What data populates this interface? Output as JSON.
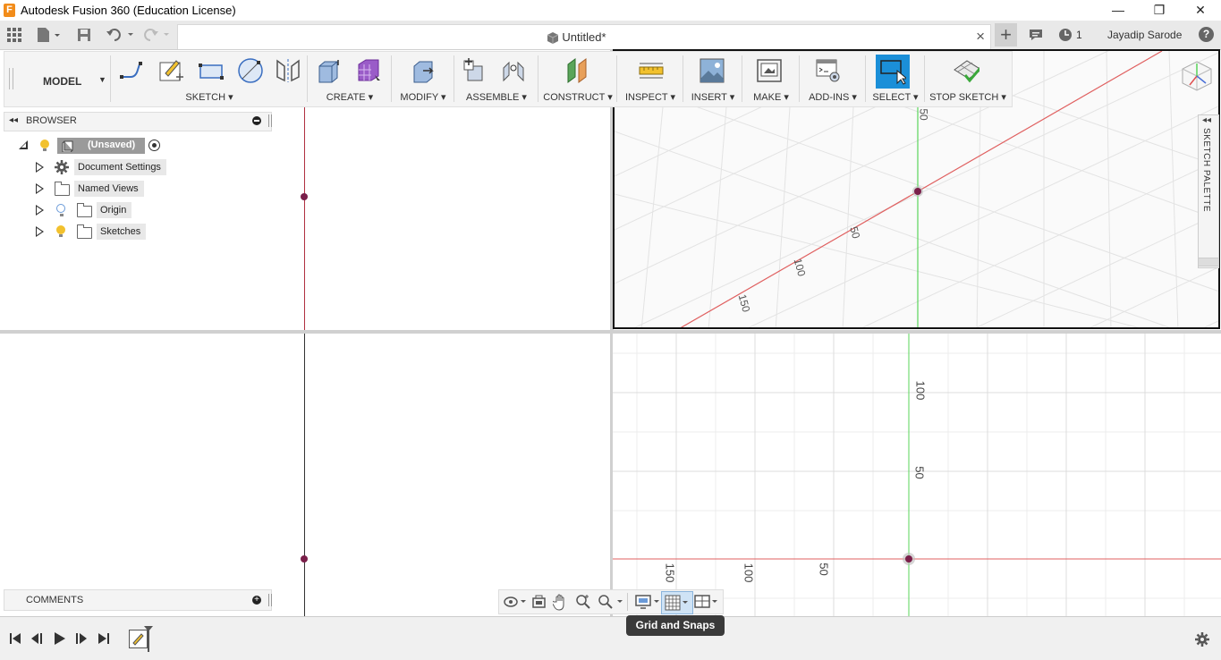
{
  "app": {
    "title": "Autodesk Fusion 360 (Education License)",
    "logo": "F"
  },
  "window_controls": {
    "minimize": "—",
    "restore": "❐",
    "close": "✕"
  },
  "appbar": {
    "doc_tab": "Untitled*",
    "tab_close": "×",
    "add_tab": "+",
    "job_count": "1",
    "user": "Jayadip Sarode",
    "help": "?"
  },
  "toolbar": {
    "workspace": "MODEL",
    "groups": {
      "sketch": "SKETCH",
      "create": "CREATE",
      "modify": "MODIFY",
      "assemble": "ASSEMBLE",
      "construct": "CONSTRUCT",
      "inspect": "INSPECT",
      "insert": "INSERT",
      "make": "MAKE",
      "addins": "ADD-INS",
      "select": "SELECT",
      "stop_sketch": "STOP SKETCH"
    }
  },
  "browser": {
    "header": "BROWSER",
    "root": "(Unsaved)",
    "items": [
      {
        "label": "Document Settings",
        "icon": "gear-icon"
      },
      {
        "label": "Named Views",
        "icon": "folder-icon"
      },
      {
        "label": "Origin",
        "icon": "folder-icon"
      },
      {
        "label": "Sketches",
        "icon": "folder-icon"
      }
    ]
  },
  "comments": {
    "label": "COMMENTS"
  },
  "sketch_palette": {
    "label": "SKETCH PALETTE"
  },
  "viewports": {
    "top_right_labels": [
      "50",
      "50",
      "100",
      "150"
    ],
    "bottom_right_vertical": [
      "100",
      "50"
    ],
    "bottom_right_horizontal": [
      "150",
      "100",
      "50"
    ]
  },
  "tooltip": "Grid and Snaps",
  "colors": {
    "accent_blue": "#1b8fd8",
    "axis_red": "#e05050",
    "axis_green": "#59d45a",
    "point": "#7a1f4a",
    "grid": "#e2e2e2"
  }
}
